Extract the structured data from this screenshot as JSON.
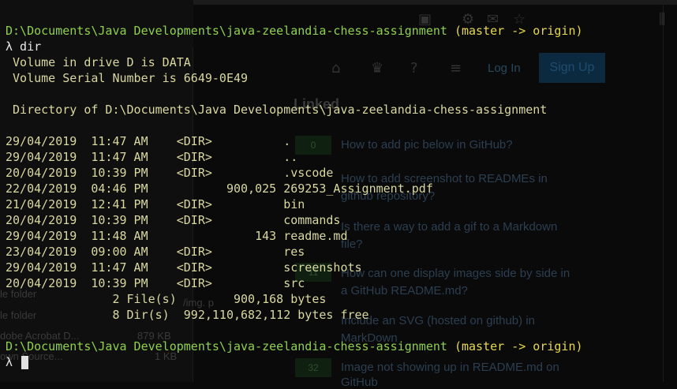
{
  "background_window": {
    "login_label": "Log In",
    "signup_label": "Sign Up",
    "heading": "Linked",
    "vote_badges": [
      "0",
      "11",
      "32"
    ],
    "related_links": [
      "How to add pic below in GitHub?",
      "How to add screenshot to READMEs in",
      "github repository?",
      "Is there a way to add a gif to a Markdown",
      "file?",
      "How can one display images side by side in",
      "a GitHub README.md?",
      "Include an SVG (hosted on github) in",
      "MarkDown",
      "Image not showing up in README.md on",
      "GitHub"
    ],
    "file_panel": {
      "row1": "le folder",
      "row2": "le folder",
      "row3_name": "dobe Acrobat D...",
      "row3_size": "879 KB",
      "row4_name": "own Source...",
      "row4_size": "1 KB",
      "path_fragment": "/img. p"
    }
  },
  "terminal": {
    "prompt_path_1": "D:\\Documents\\Java Developments\\java-zeelandia-chess-assignment",
    "prompt_branch_1": " (master -> origin)",
    "command_1": "λ dir",
    "volume_line": " Volume in drive D is DATA",
    "serial_line": " Volume Serial Number is 6649-0E49",
    "directory_line": " Directory of D:\\Documents\\Java Developments\\java-zeelandia-chess-assignment",
    "entries": [
      "29/04/2019  11:47 AM    <DIR>          .",
      "29/04/2019  11:47 AM    <DIR>          ..",
      "20/04/2019  10:39 PM    <DIR>          .vscode",
      "22/04/2019  04:46 PM           900,025 269253_Assignment.pdf",
      "21/04/2019  12:41 PM    <DIR>          bin",
      "20/04/2019  10:39 PM    <DIR>          commands",
      "29/04/2019  11:48 AM               143 readme.md",
      "23/04/2019  09:00 AM    <DIR>          res",
      "29/04/2019  11:47 AM    <DIR>          screenshots",
      "20/04/2019  10:39 PM    <DIR>          src"
    ],
    "files_summary": "               2 File(s)        900,168 bytes",
    "dirs_summary": "               8 Dir(s)  992,110,682,112 bytes free",
    "prompt_path_2": "D:\\Documents\\Java Developments\\java-zeelandia-chess-assignment",
    "prompt_branch_2": " (master -> origin)",
    "prompt_2": "λ "
  },
  "colors": {
    "path_green": "#8fd14f",
    "branch_yellow": "#e6d84f",
    "output_text": "#d8d8a0",
    "background": "#0a0a0a"
  }
}
